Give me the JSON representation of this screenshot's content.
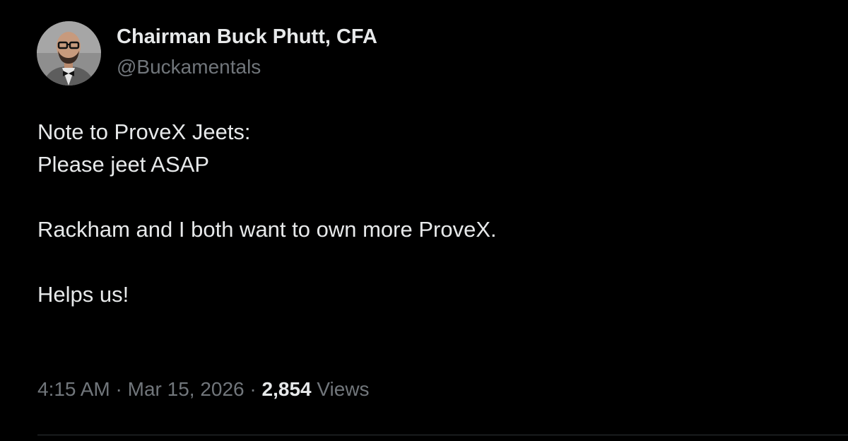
{
  "author": {
    "display_name": "Chairman Buck Phutt, CFA",
    "handle": "@Buckamentals",
    "avatar_icon": "profile-photo-avatar"
  },
  "tweet": {
    "lines": [
      "Note to ProveX Jeets:",
      "Please jeet ASAP",
      "",
      "Rackham and I both want to own more ProveX.",
      "",
      "Helps us!"
    ]
  },
  "meta": {
    "time": "4:15 AM",
    "separator": " · ",
    "date": "Mar 15, 2026",
    "views_count": "2,854",
    "views_label": "Views"
  },
  "colors": {
    "background": "#000000",
    "primary_text": "#e7e9ea",
    "secondary_text": "#71767b",
    "divider": "#2f3336"
  }
}
